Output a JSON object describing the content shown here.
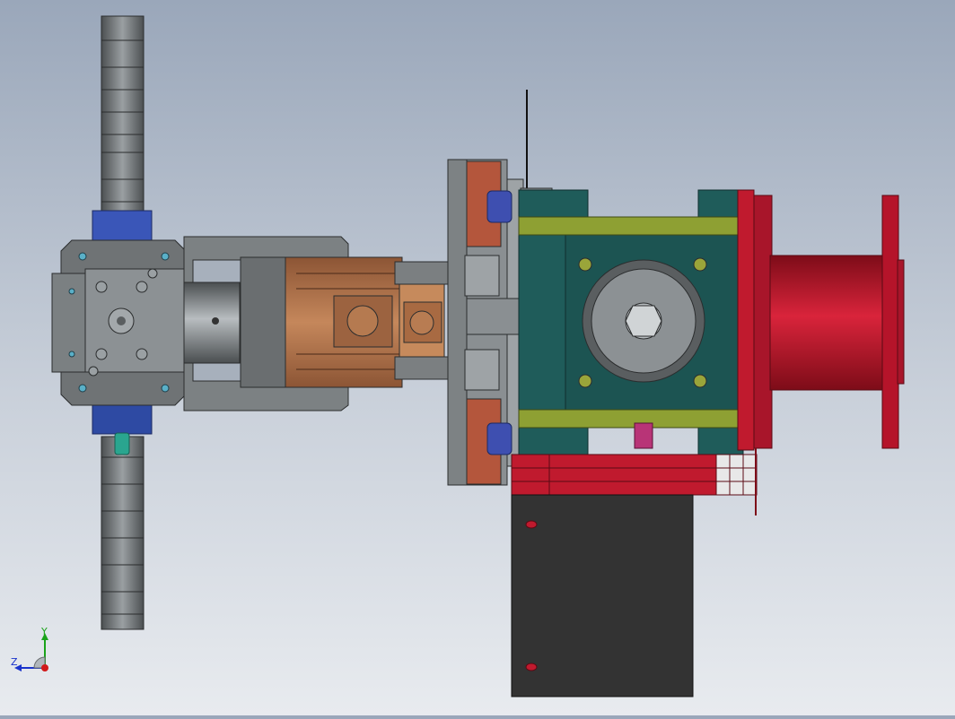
{
  "viewport": {
    "axis_triad": {
      "y_label": "Y",
      "z_label": "Z",
      "y_color": "#1aa31a",
      "z_color": "#1a33cc",
      "x_color": "#d01919"
    }
  },
  "colors": {
    "gear_gray": "#6f7375",
    "housing_gray": "#5f6466",
    "motor_copper": "#b06f45",
    "plate_teal": "#1f5c5a",
    "rail_olive": "#8ea033",
    "roller_red": "#b5142a",
    "block_red": "#c01a2e",
    "box_dark": "#333333",
    "clamp_blue": "#3a56b8",
    "bolt_yellow": "#9aa53a"
  }
}
